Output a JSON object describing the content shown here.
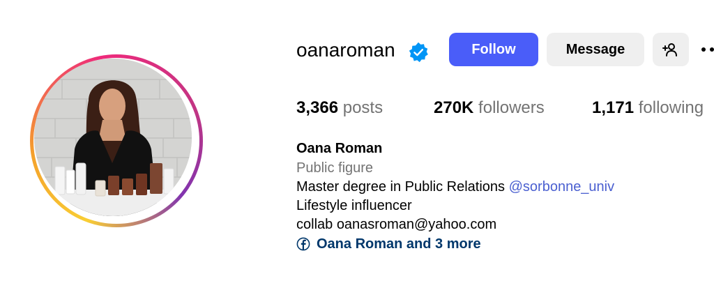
{
  "profile": {
    "username": "oanaroman",
    "verified_icon": "verified-badge-icon",
    "avatar_icon": "profile-photo",
    "buttons": {
      "follow": "Follow",
      "message": "Message",
      "add_user_icon": "person-plus-icon",
      "more_icon": "more-options-icon"
    },
    "stats": {
      "posts_count": "3,366",
      "posts_label": "posts",
      "followers_count": "270K",
      "followers_label": "followers",
      "following_count": "1,171",
      "following_label": "following"
    },
    "bio": {
      "name": "Oana Roman",
      "category": "Public figure",
      "line1_text": "Master degree in Public Relations ",
      "line1_mention": "@sorbonne_univ",
      "line2": "Lifestyle influencer",
      "line3": "collab oanasroman@yahoo.com",
      "links_icon": "facebook-icon",
      "links_text": "Oana Roman and 3 more"
    },
    "colors": {
      "follow_button": "#4a5df9",
      "secondary_button": "#efefef",
      "muted_text": "#737373",
      "mention": "#4a5fd0",
      "link": "#00376b",
      "verified": "#0095f6"
    }
  }
}
